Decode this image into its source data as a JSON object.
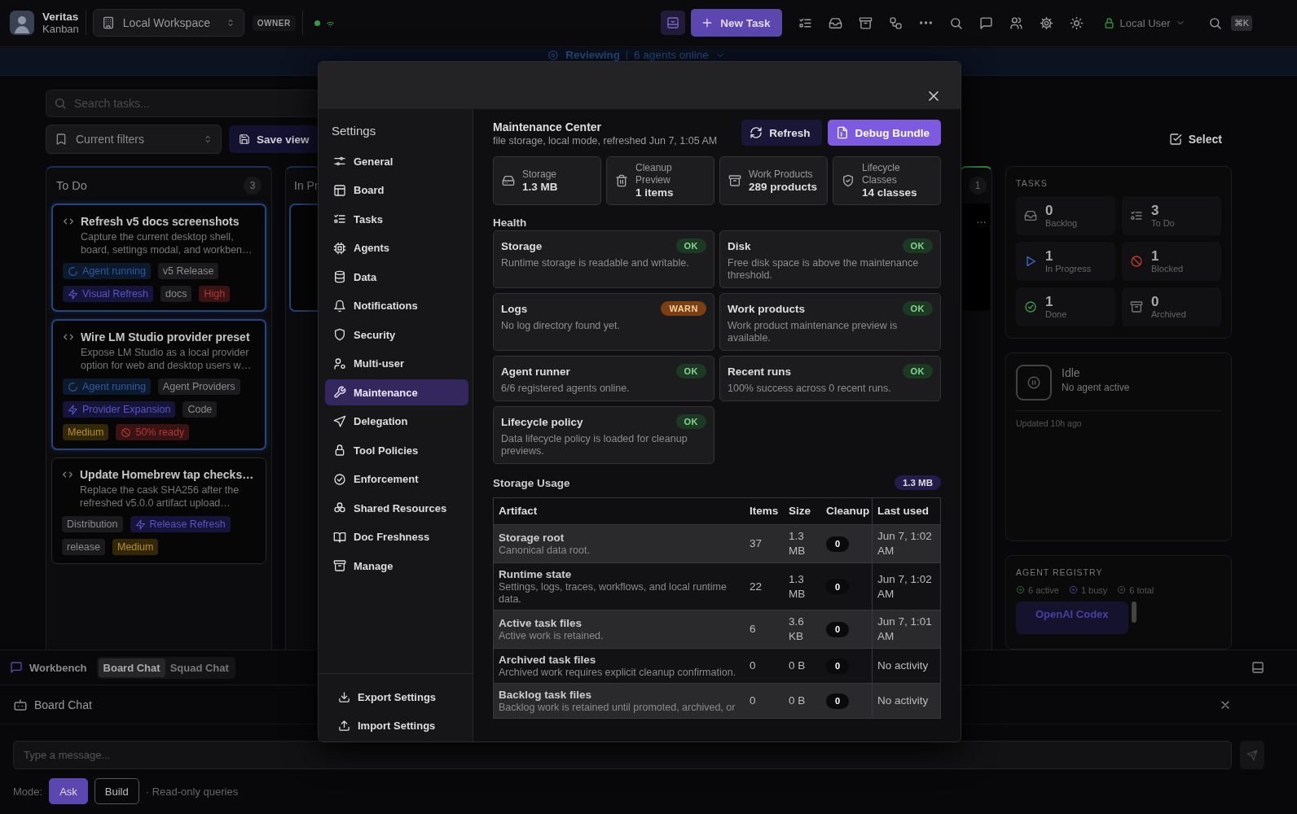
{
  "top_bar": {
    "app_name": "Veritas",
    "app_subtitle": "Kanban",
    "workspace": "Local Workspace",
    "role": "OWNER",
    "new_task": "New Task",
    "user": "Local User",
    "shortcut": "⌘K"
  },
  "status_banner": {
    "state": "Reviewing",
    "agents": "6 agents online"
  },
  "board": {
    "search": {
      "placeholder": "Search tasks..."
    },
    "saved_view": "Current filters",
    "save_view": "Save view",
    "select": "Select",
    "columns": [
      {
        "title": "To Do",
        "count": "3",
        "cards": [
          {
            "title": "Refresh v5 docs screenshots",
            "description": "Capture the current desktop shell, board, settings modal, and workben…",
            "selected": true,
            "tags": [
              {
                "kind": "agent",
                "text": "Agent running"
              },
              {
                "kind": "label",
                "text": "v5 Release"
              },
              {
                "kind": "epic",
                "text": "Visual Refresh"
              },
              {
                "kind": "label",
                "text": "docs"
              },
              {
                "kind": "high",
                "text": "High"
              }
            ]
          },
          {
            "title": "Wire LM Studio provider preset",
            "description": "Expose LM Studio as a local provider option for web and desktop users w…",
            "selected": true,
            "tags": [
              {
                "kind": "agent",
                "text": "Agent running"
              },
              {
                "kind": "label",
                "text": "Agent Providers"
              },
              {
                "kind": "epic",
                "text": "Provider Expansion"
              },
              {
                "kind": "label",
                "text": "Code"
              },
              {
                "kind": "medium",
                "text": "Medium"
              },
              {
                "kind": "readiness",
                "text": "50% ready"
              }
            ]
          },
          {
            "title": "Update Homebrew tap checks…",
            "description": "Replace the cask SHA256 after the refreshed v5.0.0 artifact upload…",
            "selected": false,
            "tags": [
              {
                "kind": "label",
                "text": "Distribution"
              },
              {
                "kind": "epic",
                "text": "Release Refresh"
              },
              {
                "kind": "label",
                "text": "release"
              },
              {
                "kind": "medium",
                "text": "Medium"
              }
            ]
          }
        ]
      },
      {
        "title": "In Pr"
      }
    ],
    "column_3": {
      "count": "1",
      "card_text": "…"
    }
  },
  "task_summary": {
    "heading": "TASKS",
    "stats": [
      {
        "value": "0",
        "label": "Backlog"
      },
      {
        "value": "3",
        "label": "To Do"
      },
      {
        "value": "1",
        "label": "In Progress"
      },
      {
        "value": "1",
        "label": "Blocked"
      },
      {
        "value": "1",
        "label": "Done"
      },
      {
        "value": "0",
        "label": "Archived"
      }
    ]
  },
  "agent_status": {
    "state": "Idle",
    "detail": "No agent active",
    "updated": "Updated 10h ago"
  },
  "agent_registry": {
    "heading": "AGENT REGISTRY",
    "active": "6 active",
    "busy": "1 busy",
    "total": "6 total",
    "agents": [
      {
        "name": "OpenAI Codex"
      }
    ]
  },
  "workbench": {
    "title": "Workbench",
    "tabs": [
      {
        "label": "Board Chat",
        "selected": true
      },
      {
        "label": "Squad Chat",
        "selected": false
      }
    ]
  },
  "board_chat": {
    "title": "Board Chat",
    "input": {
      "placeholder": "Type a message..."
    },
    "mode_label": "Mode:",
    "modes": [
      {
        "label": "Ask",
        "selected": true
      },
      {
        "label": "Build",
        "selected": false
      }
    ],
    "mode_hint": "· Read-only queries"
  },
  "settings": {
    "title": "Settings",
    "nav": [
      {
        "label": "General",
        "selected": false
      },
      {
        "label": "Board",
        "selected": false
      },
      {
        "label": "Tasks",
        "selected": false
      },
      {
        "label": "Agents",
        "selected": false
      },
      {
        "label": "Data",
        "selected": false
      },
      {
        "label": "Notifications",
        "selected": false
      },
      {
        "label": "Security",
        "selected": false
      },
      {
        "label": "Multi-user",
        "selected": false
      },
      {
        "label": "Maintenance",
        "selected": true
      },
      {
        "label": "Delegation",
        "selected": false
      },
      {
        "label": "Tool Policies",
        "selected": false
      },
      {
        "label": "Enforcement",
        "selected": false
      },
      {
        "label": "Shared Resources",
        "selected": false
      },
      {
        "label": "Doc Freshness",
        "selected": false
      },
      {
        "label": "Manage",
        "selected": false
      }
    ],
    "footer": [
      "Export Settings",
      "Import Settings"
    ],
    "maintenance": {
      "title": "Maintenance Center",
      "subtitle": "file storage, local mode, refreshed Jun 7, 1:05 AM",
      "actions": [
        "Refresh",
        "Debug Bundle"
      ],
      "stats": [
        {
          "label": "Storage",
          "value": "1.3 MB"
        },
        {
          "label": "Cleanup Preview",
          "value": "1 items"
        },
        {
          "label": "Work Products",
          "value": "289 products"
        },
        {
          "label": "Lifecycle Classes",
          "value": "14 classes"
        }
      ],
      "health_heading": "Health",
      "checks": [
        {
          "name": "Storage",
          "badge": "OK",
          "warning": false,
          "description": "Runtime storage is readable and writable."
        },
        {
          "name": "Disk",
          "badge": "OK",
          "warning": false,
          "description": "Free disk space is above the maintenance threshold."
        },
        {
          "name": "Logs",
          "badge": "WARN",
          "warning": true,
          "description": "No log directory found yet."
        },
        {
          "name": "Work products",
          "badge": "OK",
          "warning": false,
          "description": "Work product maintenance preview is available."
        },
        {
          "name": "Agent runner",
          "badge": "OK",
          "warning": false,
          "description": "6/6 registered agents online."
        },
        {
          "name": "Recent runs",
          "badge": "OK",
          "warning": false,
          "description": "100% success across 0 recent runs."
        },
        {
          "name": "Lifecycle policy",
          "badge": "OK",
          "warning": false,
          "description": "Data lifecycle policy is loaded for cleanup previews."
        }
      ],
      "usage_heading": "Storage Usage",
      "usage_total": "1.3 MB",
      "table": {
        "columns": [
          "Artifact",
          "Items",
          "Size",
          "Cleanup",
          "Last used"
        ],
        "rows": [
          {
            "artifact": "Storage root",
            "description": "Canonical data root.",
            "items": "37",
            "size": "1.3 MB",
            "cleanup": "0",
            "last_used": "Jun 7, 1:02 AM"
          },
          {
            "artifact": "Runtime state",
            "description": "Settings, logs, traces, workflows, and local runtime data.",
            "items": "22",
            "size": "1.3 MB",
            "cleanup": "0",
            "last_used": "Jun 7, 1:02 AM"
          },
          {
            "artifact": "Active task files",
            "description": "Active work is retained.",
            "items": "6",
            "size": "3.6 KB",
            "cleanup": "0",
            "last_used": "Jun 7, 1:01 AM"
          },
          {
            "artifact": "Archived task files",
            "description": "Archived work requires explicit cleanup confirmation.",
            "items": "0",
            "size": "0 B",
            "cleanup": "0",
            "last_used": "No activity"
          },
          {
            "artifact": "Backlog task files",
            "description": "Backlog work is retained until promoted, archived, or",
            "items": "0",
            "size": "0 B",
            "cleanup": "0",
            "last_used": "No activity"
          }
        ]
      }
    }
  }
}
